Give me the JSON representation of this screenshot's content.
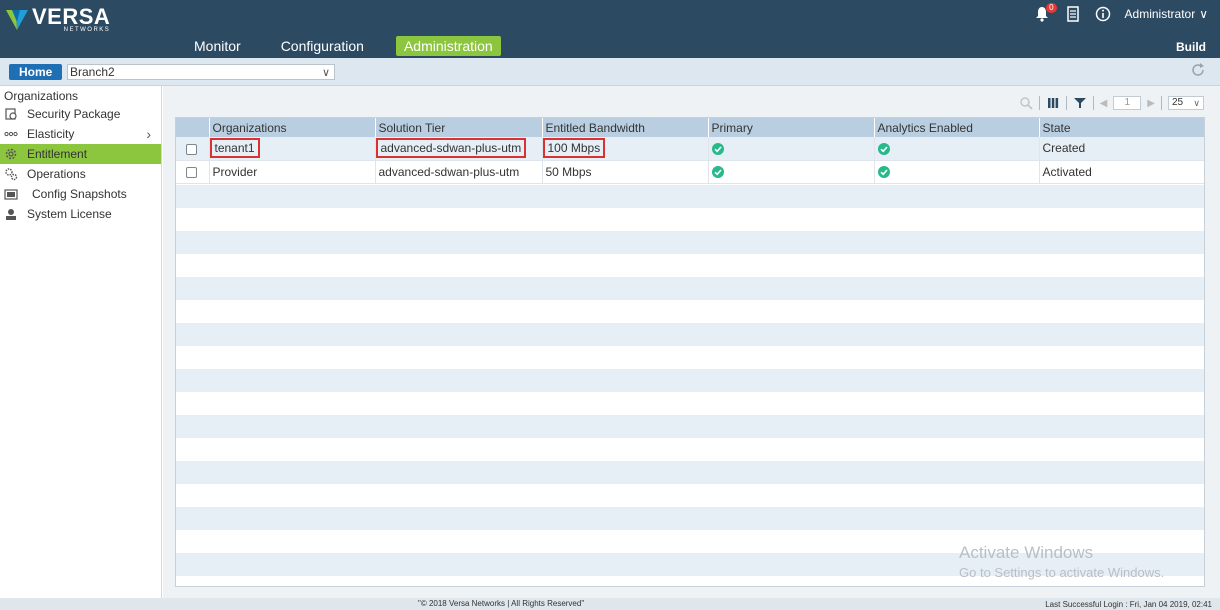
{
  "app": {
    "logo_title": "VERSA",
    "logo_sub": "NETWORKS"
  },
  "nav": [
    {
      "label": "Monitor",
      "active": false
    },
    {
      "label": "Configuration",
      "active": false
    },
    {
      "label": "Administration",
      "active": true
    }
  ],
  "header": {
    "alerts_count": "0",
    "user": "Administrator",
    "build": "Build"
  },
  "subbar": {
    "home_label": "Home",
    "appliance": "Branch2"
  },
  "sidebar": {
    "title": "Organizations",
    "items": [
      {
        "label": "Security Package",
        "icon": "security-package-icon"
      },
      {
        "label": "Elasticity",
        "icon": "elasticity-icon"
      },
      {
        "label": "Entitlement",
        "icon": "gear-icon"
      },
      {
        "label": "Operations",
        "icon": "gears-icon"
      },
      {
        "label": "Config Snapshots",
        "icon": "snapshot-icon"
      },
      {
        "label": "System License",
        "icon": "license-icon"
      }
    ]
  },
  "toolbar": {
    "page": "1",
    "page_size": "25"
  },
  "table": {
    "columns": [
      "Organizations",
      "Solution Tier",
      "Entitled Bandwidth",
      "Primary",
      "Analytics Enabled",
      "State"
    ],
    "rows": [
      {
        "organization": "tenant1",
        "tier": "advanced-sdwan-plus-utm",
        "bandwidth": "100 Mbps",
        "primary": true,
        "analytics": true,
        "state": "Created"
      },
      {
        "organization": "Provider",
        "tier": "advanced-sdwan-plus-utm",
        "bandwidth": "50 Mbps",
        "primary": true,
        "analytics": true,
        "state": "Activated"
      }
    ]
  },
  "watermark": {
    "title": "Activate Windows",
    "sub": "Go to Settings to activate Windows."
  },
  "footer": {
    "copyright": "\"© 2018 Versa Networks | All Rights Reserved\"",
    "last_login": "Last Successful Login : Fri, Jan 04 2019, 02:41"
  },
  "colors": {
    "header_bg": "#2d4a63",
    "accent_green": "#8cc63e",
    "home_blue": "#1f6fb5",
    "highlight_red": "#d9322f",
    "check_green": "#26b98a"
  }
}
